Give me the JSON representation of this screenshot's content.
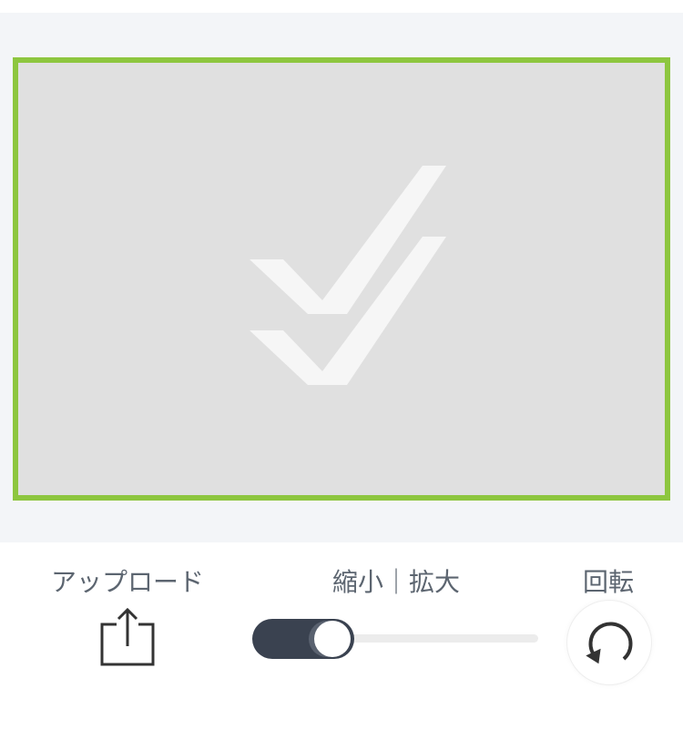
{
  "canvas": {
    "frame_color": "#8dc63f",
    "placeholder_icon": "double-checkmark-logo-icon"
  },
  "controls": {
    "upload": {
      "label": "アップロード",
      "icon": "share-upload-icon"
    },
    "zoom": {
      "label": "縮小｜拡大",
      "value_fraction": 0.3
    },
    "rotate": {
      "label": "回転",
      "icon": "rotate-icon"
    }
  },
  "colors": {
    "accent": "#8dc63f",
    "slider_fill": "#3a4250",
    "label_text": "#5c6570",
    "canvas_bg": "#e0e0e0",
    "editor_bg": "#f3f5f8"
  }
}
